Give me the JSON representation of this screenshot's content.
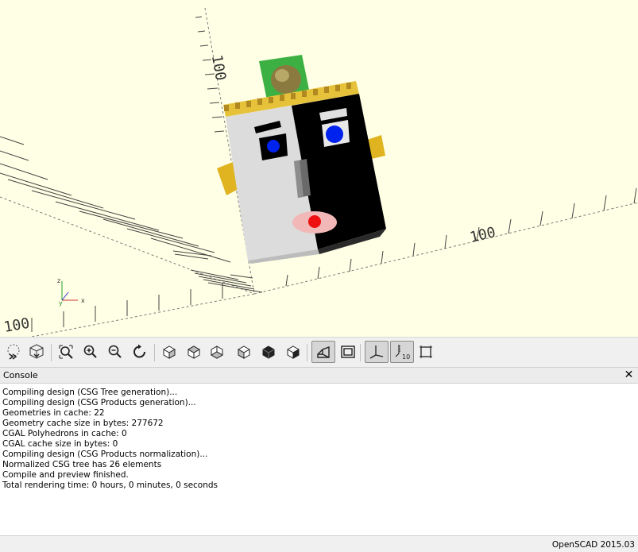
{
  "viewport": {
    "axis_labels": {
      "y_top": "100",
      "x_right": "100",
      "y_bottom": "100"
    },
    "axes_widget": {
      "z": "z",
      "y": "y",
      "x": "x"
    },
    "colors": {
      "background": "#ffffe5",
      "face_light": "#e0e0e0",
      "face_dark": "#000000",
      "hat": "#3cb043",
      "ears": "#f0c020",
      "eyes": "#0000ff",
      "nose": "#ff0000",
      "mouth": "#f2b8b8"
    }
  },
  "toolbar": {
    "buttons": [
      {
        "name": "preview",
        "icon": "preview-icon"
      },
      {
        "name": "render",
        "icon": "render-icon"
      },
      {
        "name": "view-all",
        "icon": "view-all-icon"
      },
      {
        "name": "zoom-in",
        "icon": "zoom-in-icon"
      },
      {
        "name": "zoom-out",
        "icon": "zoom-out-icon"
      },
      {
        "name": "reset-view",
        "icon": "reset-view-icon"
      },
      {
        "name": "right",
        "icon": "view-right-icon"
      },
      {
        "name": "top",
        "icon": "view-top-icon"
      },
      {
        "name": "bottom",
        "icon": "view-bottom-icon"
      },
      {
        "name": "left",
        "icon": "view-left-icon"
      },
      {
        "name": "front",
        "icon": "view-front-icon"
      },
      {
        "name": "back",
        "icon": "view-back-icon"
      },
      {
        "name": "perspective",
        "icon": "perspective-icon",
        "active": true
      },
      {
        "name": "orthogonal",
        "icon": "orthogonal-icon"
      },
      {
        "name": "show-axes",
        "icon": "show-axes-icon",
        "active": true
      },
      {
        "name": "show-scale",
        "icon": "show-scale-icon",
        "active": true,
        "label": "10"
      },
      {
        "name": "show-edges",
        "icon": "show-edges-icon"
      }
    ]
  },
  "console": {
    "title": "Console",
    "close_label": "✕",
    "lines": [
      "Compiling design (CSG Tree generation)...",
      "Compiling design (CSG Products generation)...",
      "Geometries in cache: 22",
      "Geometry cache size in bytes: 277672",
      "CGAL Polyhedrons in cache: 0",
      "CGAL cache size in bytes: 0",
      "Compiling design (CSG Products normalization)...",
      "Normalized CSG tree has 26 elements",
      "Compile and preview finished.",
      "Total rendering time: 0 hours, 0 minutes, 0 seconds"
    ]
  },
  "statusbar": {
    "version": "OpenSCAD 2015.03"
  }
}
